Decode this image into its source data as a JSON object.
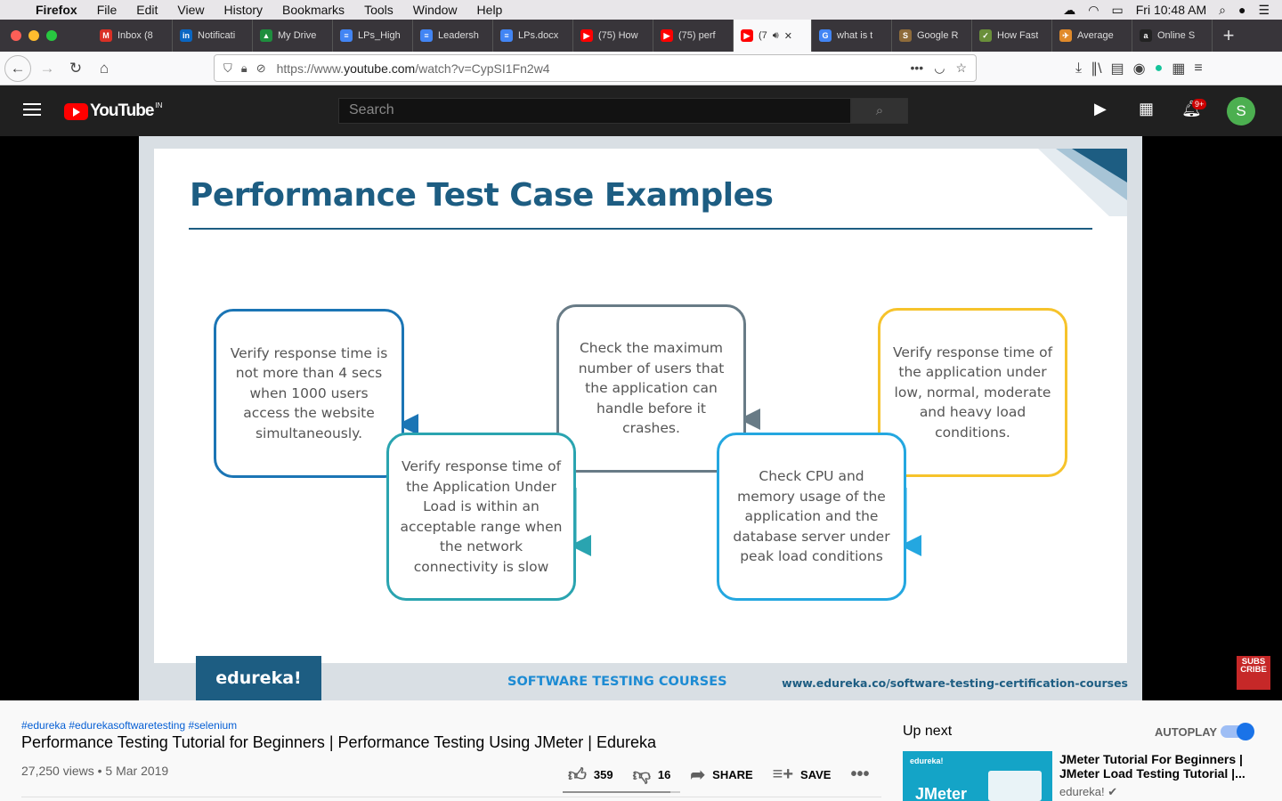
{
  "menubar": {
    "app": "Firefox",
    "items": [
      "File",
      "Edit",
      "View",
      "History",
      "Bookmarks",
      "Tools",
      "Window",
      "Help"
    ],
    "clock": "Fri 10:48 AM"
  },
  "tabs": [
    {
      "label": "Inbox (8",
      "icon": "gmail-icon",
      "color": "#d93025",
      "glyph": "M"
    },
    {
      "label": "Notificati",
      "icon": "linkedin-icon",
      "color": "#0a66c2",
      "glyph": "in"
    },
    {
      "label": "My Drive",
      "icon": "drive-icon",
      "color": "#1e8e3e",
      "glyph": "▲"
    },
    {
      "label": "LPs_High",
      "icon": "docs-icon",
      "color": "#4285f4",
      "glyph": "≡"
    },
    {
      "label": "Leadersh",
      "icon": "docs-icon",
      "color": "#4285f4",
      "glyph": "≡"
    },
    {
      "label": "LPs.docx",
      "icon": "docs-icon",
      "color": "#4285f4",
      "glyph": "≡"
    },
    {
      "label": "(75) How",
      "icon": "youtube-icon",
      "color": "#ff0000",
      "glyph": "▶"
    },
    {
      "label": "(75) perf",
      "icon": "youtube-icon",
      "color": "#ff0000",
      "glyph": "▶"
    },
    {
      "label": "(7",
      "icon": "youtube-icon",
      "color": "#ff0000",
      "glyph": "▶",
      "active": true
    },
    {
      "label": "what is t",
      "icon": "google-icon",
      "color": "#4285f4",
      "glyph": "G"
    },
    {
      "label": "Google R",
      "icon": "scholar-icon",
      "color": "#8e6b3a",
      "glyph": "S"
    },
    {
      "label": "How Fast",
      "icon": "leaf-icon",
      "color": "#6a8f3a",
      "glyph": "✓"
    },
    {
      "label": "Average",
      "icon": "plane-icon",
      "color": "#e08a2a",
      "glyph": "✈"
    },
    {
      "label": "Online S",
      "icon": "amazon-icon",
      "color": "#222222",
      "glyph": "a"
    }
  ],
  "url": {
    "prefix": "https://www.",
    "domain": "youtube.com",
    "path": "/watch?v=CypSI1Fn2w4"
  },
  "youtube": {
    "logo": "YouTube",
    "region": "IN",
    "search_placeholder": "Search",
    "notifications": "9+",
    "avatar": "S"
  },
  "slide": {
    "title": "Performance Test Case Examples",
    "boxes": [
      "Verify response time is not more than 4 secs when 1000 users access the website simultaneously.",
      "Verify response time of the Application Under Load is within an acceptable range when the network connectivity is slow",
      "Check the maximum number of users that the application can handle before it crashes.",
      "Check CPU and memory usage of the application and the database server under peak load conditions",
      "Verify response time of the application under low, normal, moderate and heavy load conditions."
    ],
    "brand": "edureka!",
    "footer_center": "SOFTWARE TESTING COURSES",
    "footer_url": "www.edureka.co/software-testing-certification-courses"
  },
  "subscribe": "SUBS CRIBE",
  "video": {
    "hashtags": "#edureka #edurekasoftwaretesting #selenium",
    "title": "Performance Testing Tutorial for Beginners | Performance Testing Using JMeter | Edureka",
    "meta": "27,250 views • 5 Mar 2019",
    "likes": "359",
    "dislikes": "16",
    "share": "SHARE",
    "save": "SAVE"
  },
  "sidebar": {
    "up_next": "Up next",
    "autoplay": "AUTOPLAY",
    "next_title": "JMeter Tutorial For Beginners | JMeter Load Testing Tutorial |...",
    "next_channel": "edureka!",
    "thumb_brand": "edureka!",
    "thumb_text": "JMeter"
  }
}
